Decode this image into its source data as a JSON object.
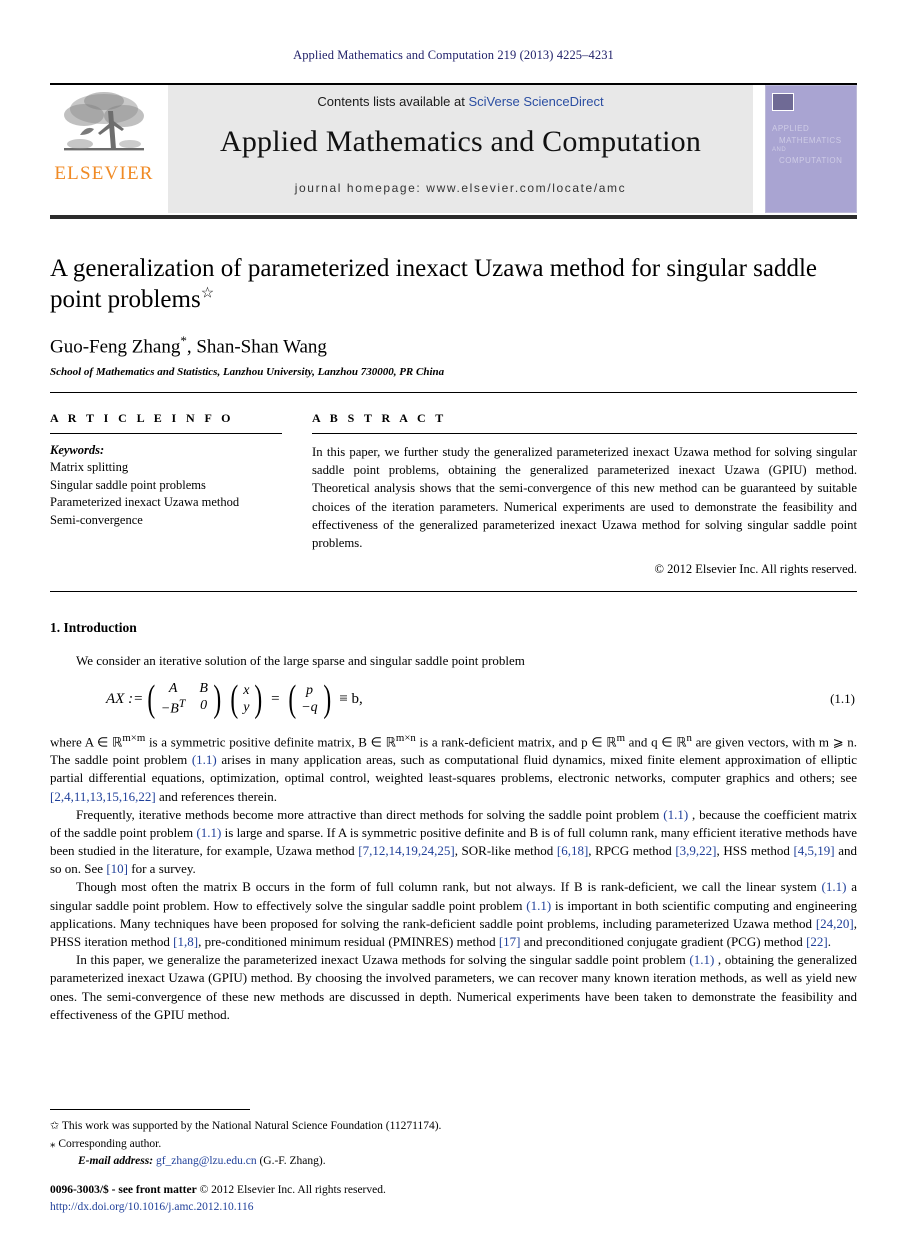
{
  "running_head": "Applied Mathematics and Computation 219 (2013) 4225–4231",
  "masthead": {
    "publisher_name": "ELSEVIER",
    "contents_prefix": "Contents lists available at ",
    "contents_link": "SciVerse ScienceDirect",
    "journal_title": "Applied Mathematics and Computation",
    "homepage": "journal homepage: www.elsevier.com/locate/amc",
    "cover": {
      "line1": "APPLIED",
      "line2": "MATHEMATICS",
      "line3": "AND",
      "line4": "COMPUTATION"
    }
  },
  "article": {
    "title": "A generalization of parameterized inexact Uzawa method for singular saddle point problems",
    "title_footnote_mark": "☆",
    "authors": "Guo-Feng Zhang",
    "author_corr_mark": "*",
    "authors_rest": ", Shan-Shan Wang",
    "affiliation": "School of Mathematics and Statistics, Lanzhou University, Lanzhou 730000, PR China"
  },
  "article_info": {
    "heading": "A R T I C L E   I N F O",
    "keywords_label": "Keywords:",
    "keywords": [
      "Matrix splitting",
      "Singular saddle point problems",
      "Parameterized inexact Uzawa method",
      "Semi-convergence"
    ]
  },
  "abstract": {
    "heading": "A B S T R A C T",
    "text": "In this paper, we further study the generalized parameterized inexact Uzawa method for solving singular saddle point problems, obtaining the generalized parameterized inexact Uzawa (GPIU) method. Theoretical analysis shows that the semi-convergence of this new method can be guaranteed by suitable choices of the iteration parameters. Numerical experiments are used to demonstrate the feasibility and effectiveness of the generalized parameterized inexact Uzawa method for solving singular saddle point problems.",
    "copyright": "© 2012 Elsevier Inc. All rights reserved."
  },
  "introduction": {
    "heading": "1. Introduction",
    "lead": "We consider an iterative solution of the large sparse and singular saddle point problem",
    "equation": {
      "lhs": "AX :=",
      "m11": "A",
      "m12": "B",
      "m21": "−B",
      "m21_sup": "T",
      "m22": "0",
      "v1": "x",
      "v2": "y",
      "r1": "p",
      "r2": "−q",
      "tail": "≡ b,",
      "number": "(1.1)"
    },
    "paragraphs": [
      {
        "id": "p1",
        "parts": [
          {
            "t": "where A ∈ ℝ",
            "k": "plain"
          },
          {
            "t": "m×m",
            "k": "sup"
          },
          {
            "t": " is a symmetric positive definite matrix, B ∈ ℝ",
            "k": "plain"
          },
          {
            "t": "m×n",
            "k": "sup"
          },
          {
            "t": " is a rank-deficient matrix, and p ∈ ℝ",
            "k": "plain"
          },
          {
            "t": "m",
            "k": "sup"
          },
          {
            "t": " and q ∈ ℝ",
            "k": "plain"
          },
          {
            "t": "n",
            "k": "sup"
          },
          {
            "t": " are given vectors, with m ⩾ n. The saddle point problem ",
            "k": "plain"
          },
          {
            "t": "(1.1)",
            "k": "ref"
          },
          {
            "t": " arises in many application areas, such as computational fluid dynamics, mixed finite element approximation of elliptic partial differential equations, optimization, optimal control, weighted least-squares problems, electronic networks, computer graphics and others; see ",
            "k": "plain"
          },
          {
            "t": "[2,4,11,13,15,16,22]",
            "k": "ref"
          },
          {
            "t": " and references therein.",
            "k": "plain"
          }
        ]
      },
      {
        "id": "p2",
        "parts": [
          {
            "t": "Frequently, iterative methods become more attractive than direct methods for solving the saddle point problem ",
            "k": "plain"
          },
          {
            "t": "(1.1)",
            "k": "ref"
          },
          {
            "t": " , because the coefficient matrix of the saddle point problem ",
            "k": "plain"
          },
          {
            "t": "(1.1)",
            "k": "ref"
          },
          {
            "t": " is large and sparse. If A is symmetric positive definite and B is of full column rank, many efficient iterative methods have been studied in the literature, for example, Uzawa method ",
            "k": "plain"
          },
          {
            "t": "[7,12,14,19,24,25]",
            "k": "ref"
          },
          {
            "t": ", SOR-like method ",
            "k": "plain"
          },
          {
            "t": "[6,18]",
            "k": "ref"
          },
          {
            "t": ", RPCG method ",
            "k": "plain"
          },
          {
            "t": "[3,9,22]",
            "k": "ref"
          },
          {
            "t": ", HSS method ",
            "k": "plain"
          },
          {
            "t": "[4,5,19]",
            "k": "ref"
          },
          {
            "t": " and so on. See ",
            "k": "plain"
          },
          {
            "t": "[10]",
            "k": "ref"
          },
          {
            "t": " for a survey.",
            "k": "plain"
          }
        ]
      },
      {
        "id": "p3",
        "parts": [
          {
            "t": "Though most often the matrix B occurs in the form of full column rank, but not always. If B is rank-deficient, we call the linear system ",
            "k": "plain"
          },
          {
            "t": "(1.1)",
            "k": "ref"
          },
          {
            "t": " a singular saddle point problem. How to effectively solve the singular saddle point problem ",
            "k": "plain"
          },
          {
            "t": "(1.1)",
            "k": "ref"
          },
          {
            "t": " is important in both scientific computing and engineering applications. Many techniques have been proposed for solving the rank-deficient saddle point problems, including parameterized Uzawa method ",
            "k": "plain"
          },
          {
            "t": "[24,20]",
            "k": "ref"
          },
          {
            "t": ", PHSS iteration method ",
            "k": "plain"
          },
          {
            "t": "[1,8]",
            "k": "ref"
          },
          {
            "t": ", pre-conditioned minimum residual (PMINRES) method ",
            "k": "plain"
          },
          {
            "t": "[17]",
            "k": "ref"
          },
          {
            "t": " and preconditioned conjugate gradient (PCG) method ",
            "k": "plain"
          },
          {
            "t": "[22]",
            "k": "ref"
          },
          {
            "t": ".",
            "k": "plain"
          }
        ]
      },
      {
        "id": "p4",
        "parts": [
          {
            "t": "In this paper, we generalize the parameterized inexact Uzawa methods for solving the singular saddle point problem ",
            "k": "plain"
          },
          {
            "t": "(1.1)",
            "k": "ref"
          },
          {
            "t": " , obtaining the generalized parameterized inexact Uzawa (GPIU) method. By choosing the involved parameters, we can recover many known iteration methods, as well as yield new ones. The semi-convergence of these new methods are discussed in depth. Numerical experiments have been taken to demonstrate the feasibility and effectiveness of the GPIU method.",
            "k": "plain"
          }
        ]
      }
    ]
  },
  "footnotes": {
    "funding_mark": "✩",
    "funding": "This work was supported by the National Natural Science Foundation (11271174).",
    "corresponding_mark": "⁎",
    "corresponding": "Corresponding author.",
    "email_label": "E-mail address:",
    "email": "gf_zhang@lzu.edu.cn",
    "email_owner": "(G.-F. Zhang)."
  },
  "colophon": {
    "issn": "0096-3003/$ - see front matter",
    "rights": "© 2012 Elsevier Inc. All rights reserved.",
    "doi": "http://dx.doi.org/10.1016/j.amc.2012.10.116"
  },
  "colors": {
    "link": "#1f3f99",
    "running_head": "#22226b",
    "elsevier_orange": "#f08a24",
    "cover_bg": "#a9a4d2",
    "masthead_bg": "#e8e8e8"
  }
}
